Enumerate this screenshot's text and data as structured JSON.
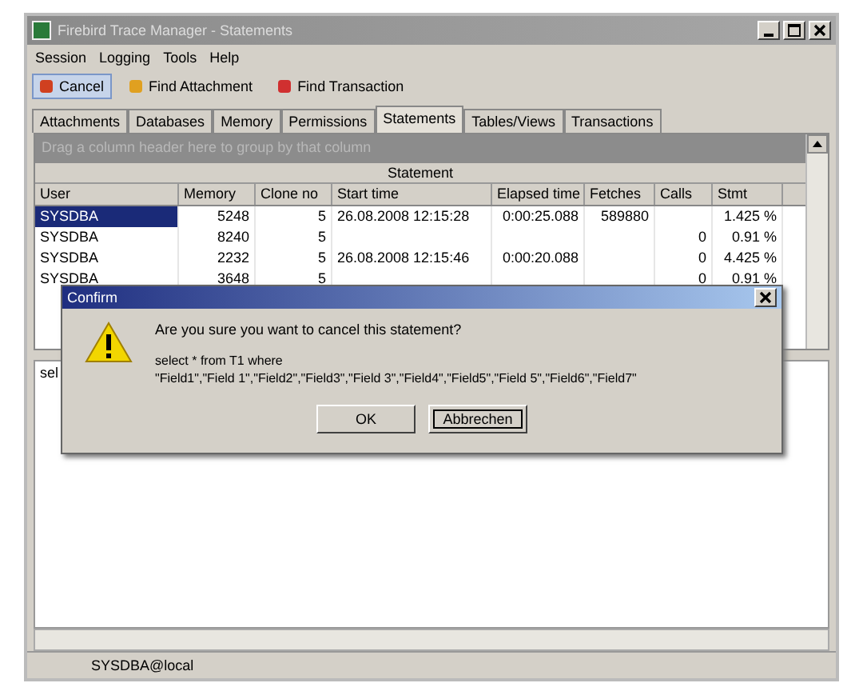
{
  "window": {
    "title": "Firebird Trace Manager - Statements"
  },
  "menu": [
    "Session",
    "Logging",
    "Tools",
    "Help"
  ],
  "toolbar": [
    {
      "label": "Cancel",
      "color": "#d04020",
      "selected": true
    },
    {
      "label": "Find Attachment",
      "color": "#e0a020",
      "selected": false
    },
    {
      "label": "Find Transaction",
      "color": "#d03030",
      "selected": false
    }
  ],
  "tabs": [
    {
      "label": "Attachments",
      "selected": false
    },
    {
      "label": "Databases",
      "selected": false
    },
    {
      "label": "Memory",
      "selected": false
    },
    {
      "label": "Permissions",
      "selected": false
    },
    {
      "label": "Statements",
      "selected": true
    },
    {
      "label": "Tables/Views",
      "selected": false
    },
    {
      "label": "Transactions",
      "selected": false
    }
  ],
  "group_hint": "Drag a column header here to group by that column",
  "table": {
    "band": "Statement",
    "columns": [
      "User",
      "Memory",
      "Clone no",
      "Start time",
      "Elapsed time",
      "Fetches",
      "Calls",
      "Stmt"
    ],
    "rows": [
      {
        "cells": [
          "SYSDBA",
          "5248",
          "5",
          "26.08.2008 12:15:28",
          "0:00:25.088",
          "589880",
          "",
          "1.425 %"
        ],
        "selected": true
      },
      {
        "cells": [
          "SYSDBA",
          "8240",
          "5",
          "",
          "",
          "",
          "0",
          "0.91 %"
        ],
        "selected": false
      },
      {
        "cells": [
          "SYSDBA",
          "2232",
          "5",
          "26.08.2008 12:15:46",
          "0:00:20.088",
          "",
          "0",
          "4.425 %"
        ],
        "selected": false
      },
      {
        "cells": [
          "SYSDBA",
          "3648",
          "5",
          "",
          "",
          "",
          "0",
          "0.91 %"
        ],
        "selected": false
      }
    ]
  },
  "editor": {
    "text": "sel"
  },
  "dialog": {
    "title": "Confirm",
    "message": "Are you sure you want to cancel this statement?",
    "sql_line_1": "select * from T1 where",
    "sql_line_2": "\"Field1\",\"Field 1\",\"Field2\",\"Field3\",\"Field 3\",\"Field4\",\"Field5\",\"Field 5\",\"Field6\",\"Field7\"",
    "buttons": [
      {
        "label": "OK",
        "focused": false
      },
      {
        "label": "Abbrechen",
        "focused": true
      }
    ]
  },
  "status_bar": {
    "text": "SYSDBA@local"
  }
}
